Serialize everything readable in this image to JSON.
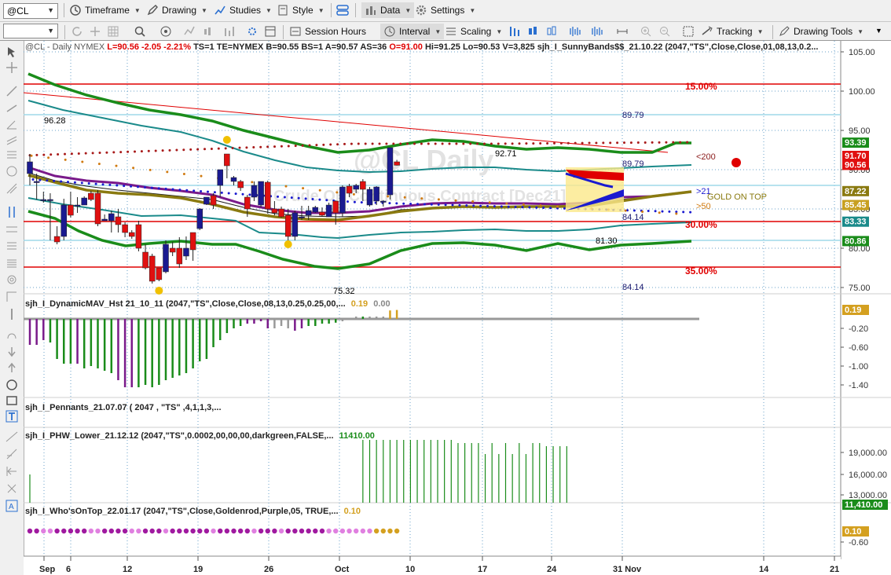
{
  "toolbar": {
    "symbol": "@CL",
    "timeframe": "Timeframe",
    "drawing": "Drawing",
    "studies": "Studies",
    "style": "Style",
    "data": "Data",
    "settings": "Settings",
    "session_hours": "Session Hours",
    "interval": "Interval",
    "scaling": "Scaling",
    "tracking": "Tracking",
    "drawing_tools": "Drawing Tools"
  },
  "colors": {
    "green_band": "#1a8c1a",
    "teal_band": "#1a8a8a",
    "purple": "#7a1a8a",
    "olive": "#8a7a10",
    "red_line": "#e00000",
    "bull": "#1a1a90",
    "bear": "#e01010",
    "gold": "#f0c000"
  },
  "main_header": {
    "symbol": "@CL - Daily NYMEX",
    "last": "L=90.56",
    "change": "-2.05",
    "pct": "-2.21%",
    "rest": "TS=1 TE=NYMEX B=90.55 BS=1 A=90.57 AS=36",
    "open": "O=91.00",
    "rest2": "Hi=91.25 Lo=90.53 V=3,825",
    "study": "sjh_I_SunnyBands$$_21.10.22 (2047,\"TS\",Close,Close,01,08,13,0.2..."
  },
  "watermark": {
    "symbol": "@CL Daily",
    "name": "Crude Oil Continuous Contract [Dec21]"
  },
  "price_axis": [
    "105.00",
    "100.00",
    "95.00",
    "90.00",
    "85.00",
    "80.00",
    "75.00"
  ],
  "price_badges": [
    {
      "text": "93.39",
      "color": "#1a8c1a"
    },
    {
      "text": "91.70",
      "color": "#e01010"
    },
    {
      "text": "90.56",
      "color": "#e01010"
    },
    {
      "text": "87.22",
      "color": "#8a7a10"
    },
    {
      "text": "85.45",
      "color": "#c8a020"
    },
    {
      "text": "83.33",
      "color": "#1a8a8a"
    },
    {
      "text": "80.86",
      "color": "#1a8c1a"
    }
  ],
  "chart_labels": {
    "l1": "96.28",
    "l2": "92.71",
    "l3": "89.79",
    "l4": "89.79",
    "l5": "84.14",
    "l6": "81.30",
    "l7": "75.32",
    "l8": "84.14",
    "pct15": "15.00%",
    "pct30": "30.00%",
    "pct35": "35.00%",
    "gt200": "<200",
    "gt21": ">21",
    "gt50": ">50",
    "gold": "GOLD ON TOP"
  },
  "panel_dmav": {
    "title": "sjh_I_DynamicMAV_Hst 21_10_11 (2047,\"TS\",Close,Close,08,13,0.25,0.25,00,...",
    "v1": "0.19",
    "v2": "0.00",
    "axis": [
      "-0.20",
      "-0.60",
      "-1.00",
      "-1.40"
    ],
    "badge": "0.19"
  },
  "panel_pennants": {
    "title": "sjh_I_Pennants_21.07.07 ( 2047 , \"TS\" ,4,1,1,3,..."
  },
  "panel_phw": {
    "title": "sjh_I_PHW_Lower_21.12.12 (2047,\"TS\",0.0002,00,00,00,darkgreen,FALSE,...",
    "v1": "11410.00",
    "axis": [
      "19,000.00",
      "16,000.00",
      "13,000.00"
    ],
    "badge": "11,410.00"
  },
  "panel_who": {
    "title": "sjh_I_Who'sOnTop_22.01.17 (2047,\"TS\",Close,Goldenrod,Purple,05, TRUE,...",
    "v1": "0.10",
    "axis": [
      "-0.60"
    ],
    "badge": "0.10"
  },
  "x_axis": [
    "Sep",
    "6",
    "12",
    "19",
    "26",
    "Oct",
    "10",
    "17",
    "24",
    "31 Nov",
    "14",
    "21"
  ],
  "candles": [
    [
      89.5,
      91.0,
      88.0,
      92.0
    ],
    [
      88.5,
      88.5,
      86.2,
      89.5
    ],
    [
      86.2,
      86.2,
      85.8,
      87.2
    ],
    [
      86.2,
      86.2,
      81.0,
      87.0
    ],
    [
      81.5,
      80.8,
      80.5,
      82.8
    ],
    [
      81.5,
      85.5,
      81.0,
      86.3
    ],
    [
      85.5,
      84.2,
      83.9,
      87.2
    ],
    [
      85.5,
      85.5,
      84.5,
      86.5
    ],
    [
      85.5,
      86.4,
      85.5,
      86.6
    ],
    [
      87.0,
      86.2,
      86.0,
      87.3
    ],
    [
      87.0,
      83.1,
      82.8,
      87.4
    ],
    [
      83.5,
      83.7,
      83.5,
      84.3
    ],
    [
      83.5,
      84.4,
      82.0,
      84.8
    ],
    [
      84.0,
      83.0,
      82.0,
      85.0
    ],
    [
      83.0,
      82.0,
      81.4,
      83.3
    ],
    [
      82.0,
      81.5,
      81.2,
      82.3
    ],
    [
      83.0,
      80.0,
      79.6,
      83.5
    ],
    [
      79.5,
      77.5,
      77.3,
      80.5
    ],
    [
      79.0,
      75.8,
      75.5,
      79.3
    ],
    [
      77.5,
      76.0,
      75.8,
      77.5
    ],
    [
      77.0,
      80.5,
      76.8,
      81.0
    ],
    [
      80.0,
      79.5,
      79.0,
      80.8
    ],
    [
      80.0,
      78.0,
      77.5,
      81.4
    ],
    [
      79.0,
      80.0,
      78.5,
      81.5
    ],
    [
      82.0,
      79.8,
      78.4,
      81.8
    ],
    [
      82.5,
      85.0,
      82.3,
      85.1
    ],
    [
      85.6,
      86.5,
      85.5,
      86.0
    ],
    [
      86.7,
      85.5,
      85.0,
      87.0
    ],
    [
      88.0,
      90.0,
      86.5,
      90.0
    ],
    [
      92.0,
      90.5,
      88.9,
      92.0
    ],
    [
      88.5,
      89.0,
      88.0,
      89.2
    ],
    [
      88.5,
      87.7,
      87.3,
      88.7
    ],
    [
      86.5,
      85.0,
      84.0,
      86.8
    ],
    [
      86.5,
      88.0,
      86.0,
      88.5
    ],
    [
      85.5,
      88.5,
      85.2,
      88.5
    ],
    [
      88.4,
      85.0,
      84.4,
      88.6
    ],
    [
      85.0,
      84.5,
      84.2,
      86.0
    ],
    [
      85.0,
      84.0,
      83.9,
      85.3
    ],
    [
      84.2,
      81.5,
      81.0,
      85.0
    ],
    [
      81.5,
      84.5,
      81.0,
      84.8
    ],
    [
      84.0,
      84.0,
      83.6,
      85.4
    ],
    [
      84.2,
      84.8,
      83.6,
      85.4
    ],
    [
      84.6,
      85.2,
      84.5,
      85.4
    ],
    [
      84.6,
      84.2,
      84.0,
      85.2
    ],
    [
      84.0,
      85.5,
      84.0,
      85.8
    ],
    [
      86.0,
      84.5,
      83.0,
      86.1
    ],
    [
      84.5,
      87.8,
      84.0,
      88.0
    ],
    [
      87.9,
      87.0,
      86.5,
      88.2
    ],
    [
      87.5,
      88.0,
      87.0,
      88.2
    ],
    [
      88.5,
      87.5,
      86.0,
      88.8
    ],
    [
      85.5,
      87.5,
      85.3,
      87.8
    ],
    [
      86.0,
      87.8,
      85.5,
      87.9
    ],
    [
      86.0,
      86.0,
      85.3,
      86.1
    ],
    [
      86.8,
      92.8,
      86.2,
      92.8
    ],
    [
      91.0,
      90.56,
      90.53,
      91.25
    ]
  ]
}
